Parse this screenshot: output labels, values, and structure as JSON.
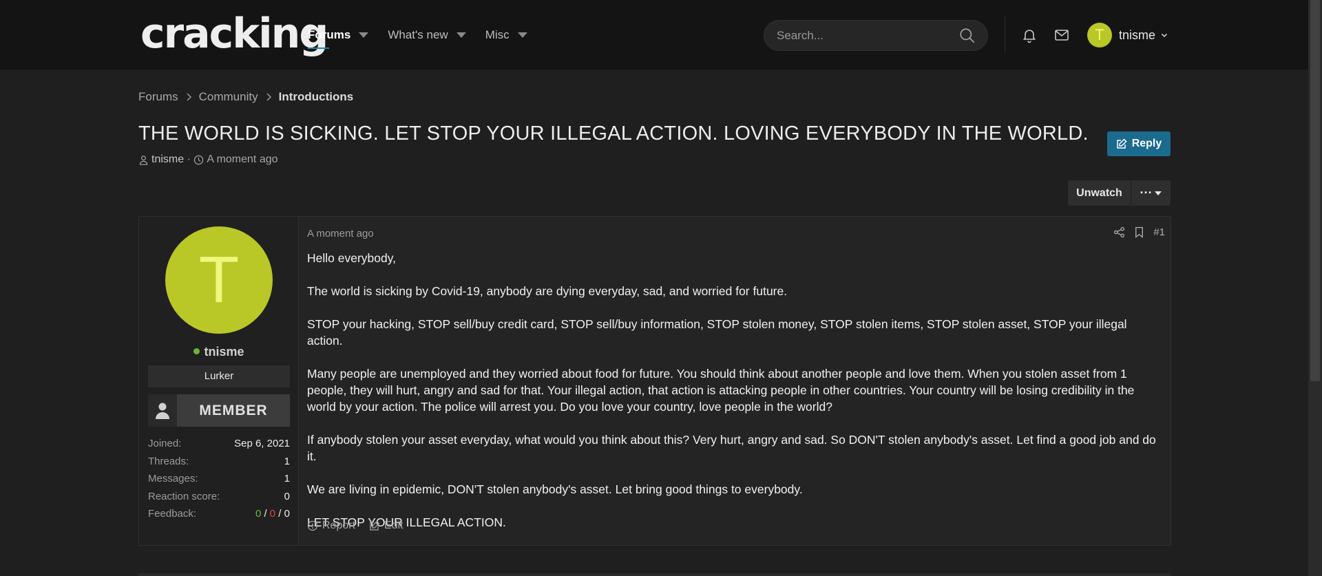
{
  "header": {
    "logo": "cracking",
    "nav": [
      {
        "label": "Forums"
      },
      {
        "label": "What's new"
      },
      {
        "label": "Misc"
      }
    ],
    "search_placeholder": "Search...",
    "username": "tnisme",
    "avatar_letter": "T"
  },
  "breadcrumb": {
    "items": [
      "Forums",
      "Community",
      "Introductions"
    ]
  },
  "thread": {
    "title": "THE WORLD IS SICKING. LET STOP YOUR ILLEGAL ACTION. LOVING EVERYBODY IN THE WORLD.",
    "author": "tnisme",
    "time": "A moment ago",
    "reply_label": "Reply",
    "unwatch_label": "Unwatch",
    "more_label": "···"
  },
  "user": {
    "avatar_letter": "T",
    "name": "tnisme",
    "title": "Lurker",
    "banner": "MEMBER",
    "stats": [
      {
        "key": "Joined:",
        "value": "Sep 6, 2021"
      },
      {
        "key": "Threads:",
        "value": "1"
      },
      {
        "key": "Messages:",
        "value": "1"
      },
      {
        "key": "Reaction score:",
        "value": "0"
      }
    ],
    "feedback_key": "Feedback:",
    "feedback": {
      "positive": "0",
      "negative": "0",
      "neutral": "0",
      "sep": " / "
    }
  },
  "post": {
    "date": "A moment ago",
    "number": "#1",
    "paragraphs": [
      "Hello everybody,",
      "The world is sicking by Covid-19, anybody are dying everyday, sad, and worried for future.",
      "STOP your hacking, STOP sell/buy credit card, STOP sell/buy information, STOP stolen money, STOP stolen items, STOP stolen asset, STOP your illegal action.",
      "Many people are unemployed and they worried about food for future. You should think about another people and love them. When you stolen asset from 1 people, they will hurt, angry and sad for that. Your illegal action, that action is attacking people in other countries. Your country will be losing credibility in the world by your action. The police will arrest you. Do you love your country, love people in the world?",
      "If anybody stolen your asset everyday, what would you think about this? Very hurt, angry and sad. So DON'T stolen anybody's asset. Let find a good job and do it.",
      "We are living in epidemic, DON'T stolen anybody's asset. Let bring good things to everybody.",
      "LET STOP YOUR ILLEGAL ACTION."
    ],
    "report_label": "Report",
    "edit_label": "Edit"
  },
  "colors": {
    "accent": "#1b6b8f",
    "avatar": "#b9c826",
    "online": "#6bb53a"
  }
}
